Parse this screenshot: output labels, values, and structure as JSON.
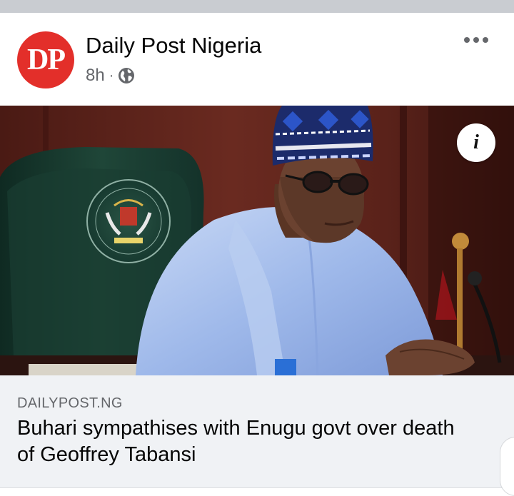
{
  "post": {
    "page_name": "Daily Post Nigeria",
    "logo_text": "DP",
    "time_ago": "8h",
    "separator": "·",
    "audience_icon": "globe-icon",
    "more_icon": "more-options-icon"
  },
  "media": {
    "info_label": "i",
    "seal_text": "SEAL OF THE PRESIDENT OF THE FEDERAL REPUBLIC OF NIGERIA"
  },
  "link_preview": {
    "domain": "DAILYPOST.NG",
    "headline": "Buhari sympathises with Enugu govt over death of Geoffrey Tabansi"
  },
  "colors": {
    "logo_red": "#e32f2a",
    "preview_bg": "#f0f2f5",
    "meta_gray": "#65676b"
  }
}
